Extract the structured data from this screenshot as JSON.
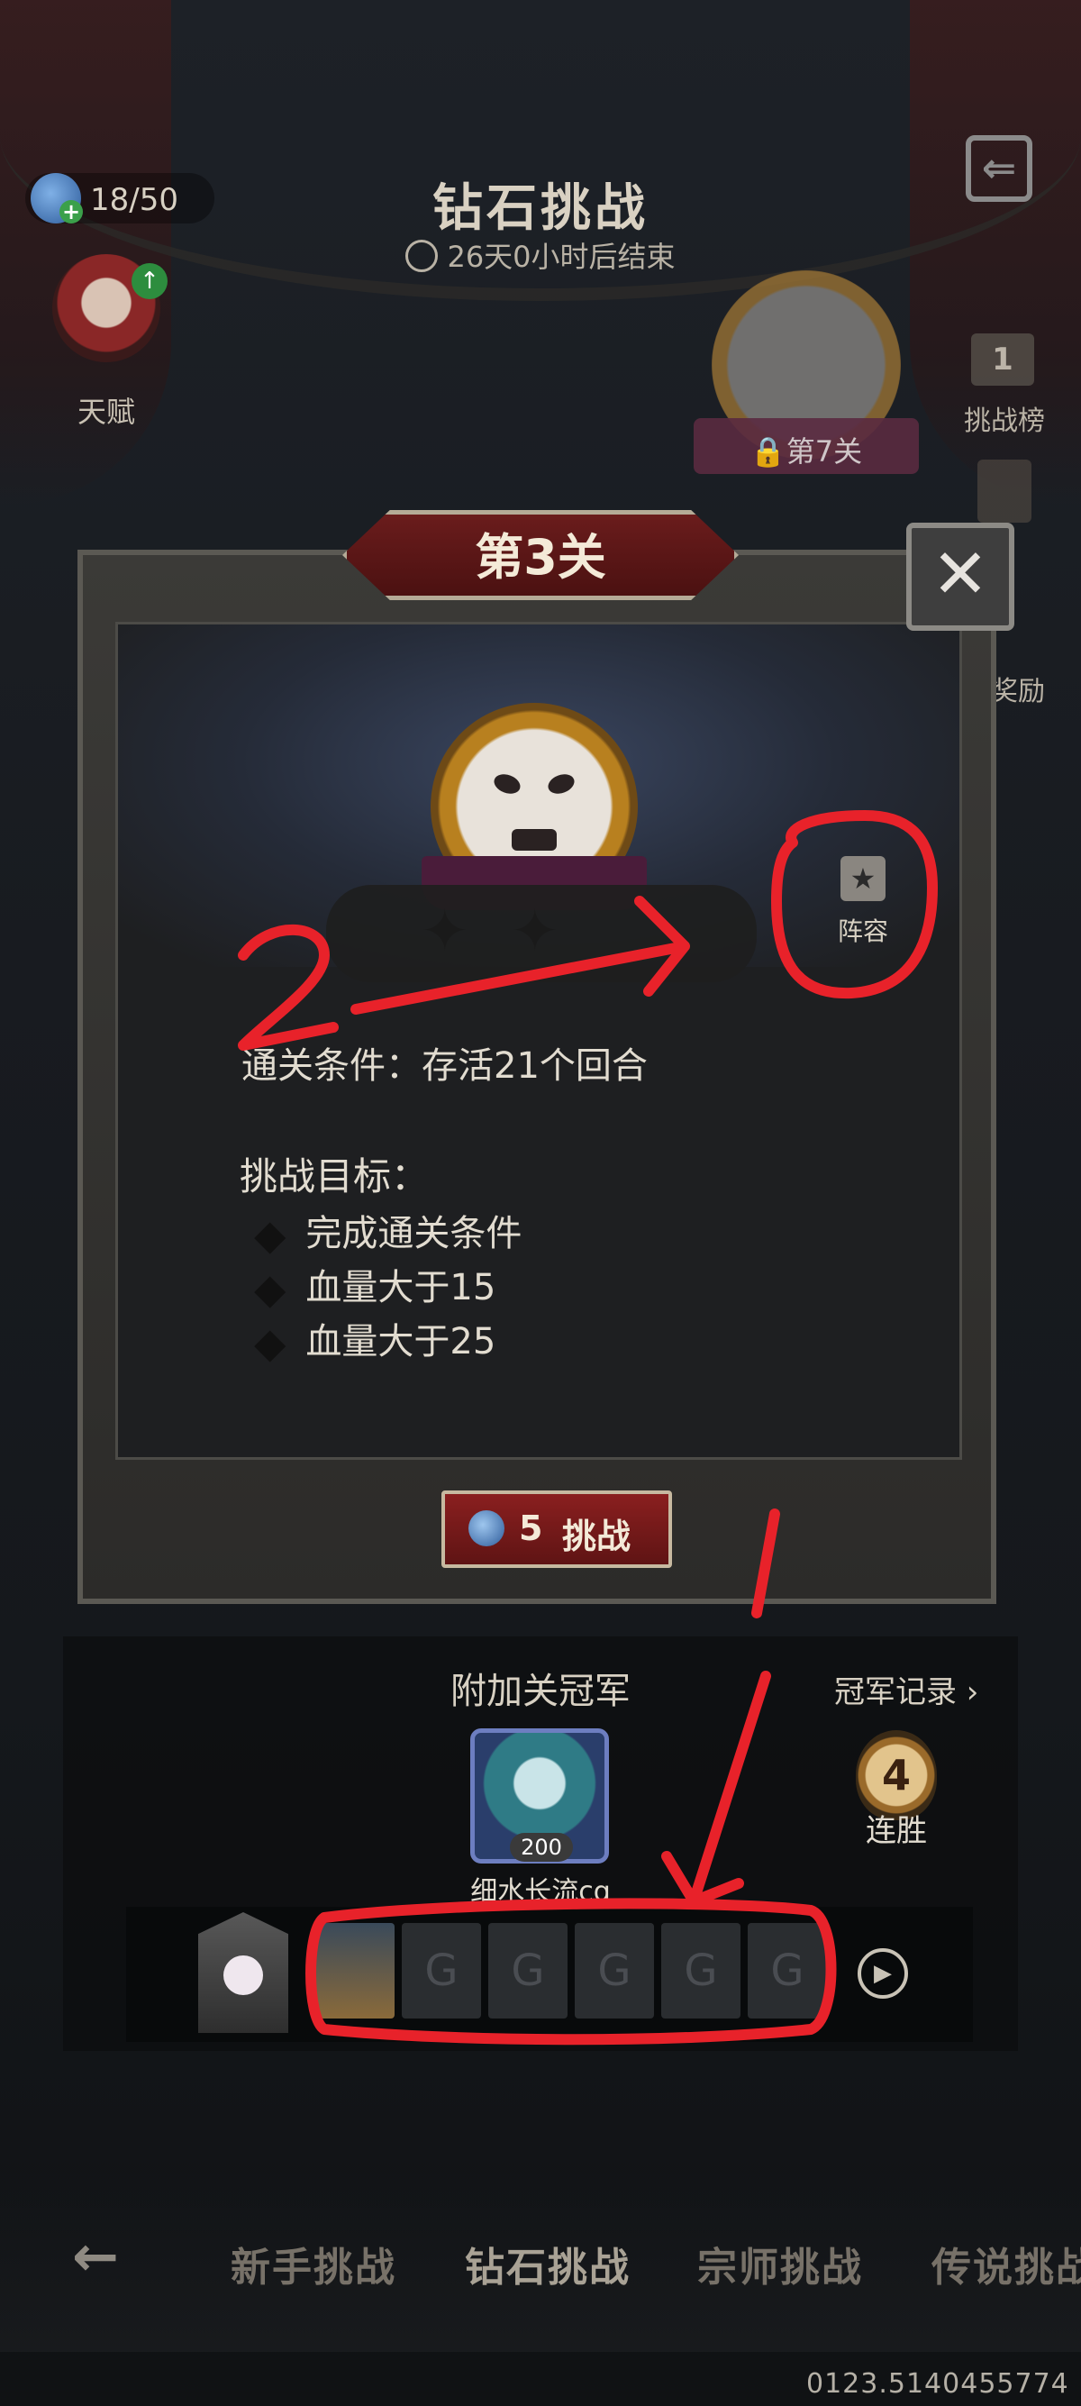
{
  "header": {
    "title": "钻石挑战",
    "timer": "26天0小时后结束",
    "stamina": "18/50",
    "talent_label": "天赋"
  },
  "side_menu": {
    "next_level": "第7关",
    "rank_icon_text": "1",
    "rank_label": "挑战榜",
    "reward_label": "奖励"
  },
  "modal": {
    "level_title": "第3关",
    "close_symbol": "✕",
    "lineup_label": "阵容",
    "clear_condition": "通关条件：存活21个回合",
    "goal_title": "挑战目标：",
    "goals": [
      "完成通关条件",
      "血量大于15",
      "血量大于25"
    ],
    "goal_marker": "◆",
    "star_symbol": "✦",
    "challenge_cost": "5",
    "challenge_label": "挑战"
  },
  "champion": {
    "title": "附加关冠军",
    "record_link": "冠军记录 ›",
    "score": "200",
    "name": "细水长流cg",
    "streak": "4",
    "streak_label": "连胜"
  },
  "team_bar": {
    "empty_slot_symbol": "G",
    "replay_symbol": "▶"
  },
  "bottom_nav": {
    "back_symbol": "←",
    "tabs": [
      "新手挑战",
      "钻石挑战",
      "宗师挑战",
      "传说挑战"
    ]
  },
  "footer": {
    "user_id": "0123.5140455774"
  },
  "annotations": {
    "label_1": "1",
    "label_2": "2",
    "color": "#e8222a"
  }
}
